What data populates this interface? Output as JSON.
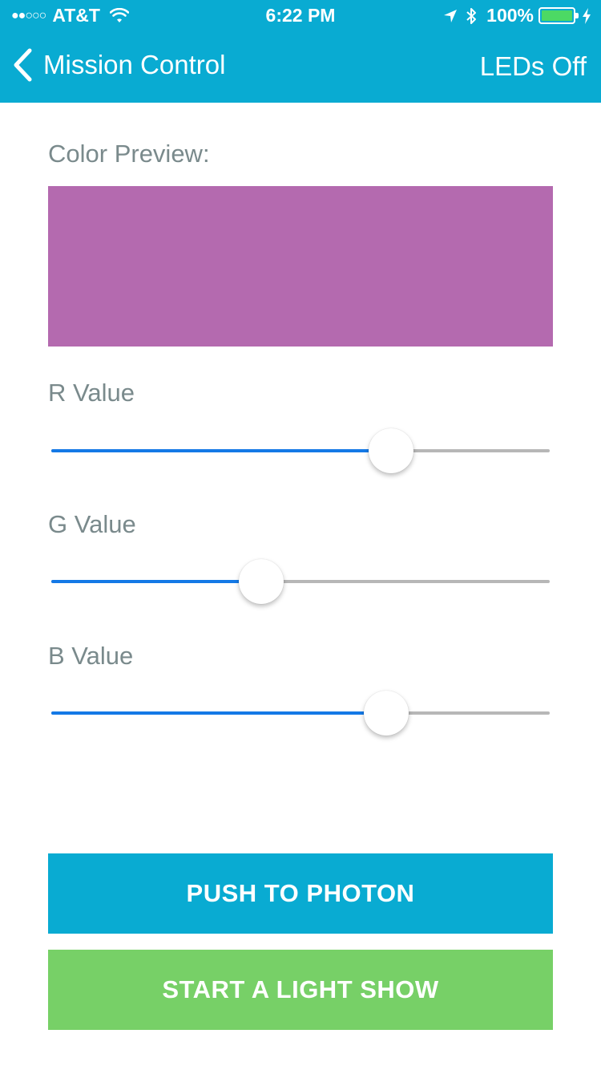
{
  "status_bar": {
    "signal": "●●○○○",
    "carrier": "AT&T",
    "time": "6:22 PM",
    "battery": "100%",
    "battery_color": "#4cd964"
  },
  "nav": {
    "back_label": "Mission Control",
    "right_label": "LEDs Off",
    "color": "#09abd2"
  },
  "preview": {
    "label": "Color Preview:",
    "color": "#b46aaf"
  },
  "sliders": [
    {
      "label": "R Value",
      "fraction": 0.682
    },
    {
      "label": "G Value",
      "fraction": 0.422
    },
    {
      "label": "B Value",
      "fraction": 0.672
    }
  ],
  "buttons": {
    "push": "PUSH TO PHOTON",
    "push_color": "#09abd2",
    "show": "START A LIGHT SHOW",
    "show_color": "#77d067"
  }
}
